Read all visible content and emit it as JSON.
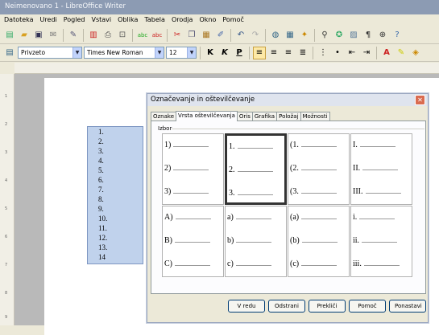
{
  "window": {
    "title": "Neimenovano 1 - LibreOffice Writer"
  },
  "menu": [
    "Datoteka",
    "Uredi",
    "Pogled",
    "Vstavi",
    "Oblika",
    "Tabela",
    "Orodja",
    "Okno",
    "Pomoč"
  ],
  "formatting": {
    "style": "Privzeto",
    "font": "Times New Roman",
    "size": "12"
  },
  "document": {
    "numbered_items": [
      "1.",
      "2.",
      "3.",
      "4.",
      "5.",
      "6.",
      "7.",
      "8.",
      "9.",
      "10.",
      "11.",
      "12.",
      "13.",
      "14"
    ]
  },
  "ruler_v": [
    "1",
    "2",
    "3",
    "4",
    "5",
    "6",
    "7",
    "8",
    "9"
  ],
  "dialog": {
    "title": "Označevanje in oštevilčevanje",
    "tabs": [
      "Oznake",
      "Vrsta oštevilčevanja",
      "Oris",
      "Grafika",
      "Položaj",
      "Možnosti"
    ],
    "active_tab": "Vrsta oštevilčevanja",
    "group_label": "Izbor",
    "selected_index": 1,
    "cells": [
      [
        "1)",
        "2)",
        "3)"
      ],
      [
        "1.",
        "2.",
        "3."
      ],
      [
        "(1.",
        "(2.",
        "(3."
      ],
      [
        "I.",
        "II.",
        "III."
      ],
      [
        "A)",
        "B)",
        "C)"
      ],
      [
        "a)",
        "b)",
        "c)"
      ],
      [
        "(a)",
        "(b)",
        "(c)"
      ],
      [
        "i.",
        "ii.",
        "iii."
      ]
    ],
    "buttons": [
      "V redu",
      "Odstrani",
      "Prekliči",
      "Pomoč",
      "Ponastavi"
    ]
  }
}
